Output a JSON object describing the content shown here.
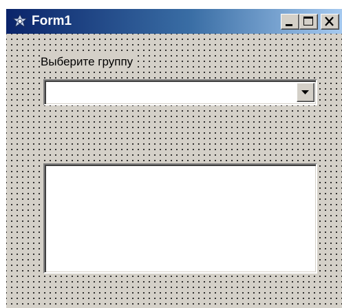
{
  "window": {
    "title": "Form1",
    "icon": "delphi-form-icon",
    "buttons": {
      "minimize_icon": "minimize-icon",
      "maximize_icon": "maximize-icon",
      "close_icon": "close-icon"
    },
    "colors": {
      "titlebar_start": "#0a246a",
      "titlebar_end": "#a6caf0",
      "face": "#d4d0c8"
    }
  },
  "form": {
    "group_label": "Выберите группу",
    "group_combo": {
      "selected_value": ""
    },
    "result_list": {
      "items": []
    }
  }
}
